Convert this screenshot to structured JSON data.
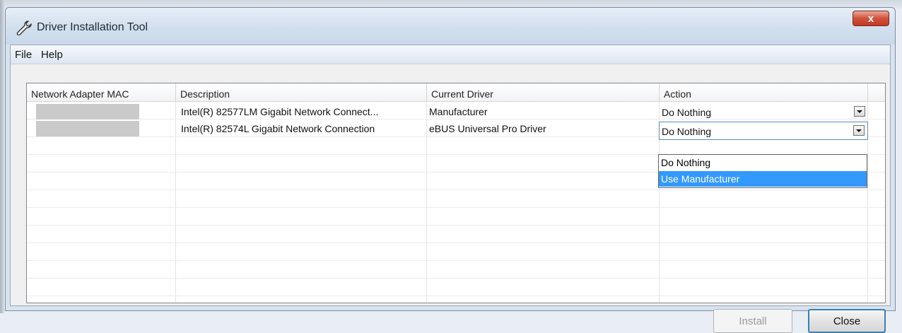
{
  "window": {
    "title": "Driver Installation Tool",
    "close_glyph": "x"
  },
  "menu": [
    "File",
    "Help"
  ],
  "table": {
    "columns": [
      "Network Adapter MAC",
      "Description",
      "Current Driver",
      "Action"
    ],
    "rows": [
      {
        "mac": "",
        "description": "Intel(R) 82577LM Gigabit Network Connect...",
        "current_driver": "Manufacturer",
        "action": "Do Nothing"
      },
      {
        "mac": "",
        "description": "Intel(R) 82574L Gigabit Network Connection",
        "current_driver": "eBUS Universal Pro Driver",
        "action": "Do Nothing"
      }
    ]
  },
  "dropdown": {
    "options": [
      "Do Nothing",
      "Use Manufacturer"
    ],
    "highlighted": "Use Manufacturer",
    "highlight_color": "#3399ff"
  },
  "buttons": {
    "install": "Install",
    "close": "Close"
  },
  "icons": {
    "title": "wrench-icon"
  }
}
